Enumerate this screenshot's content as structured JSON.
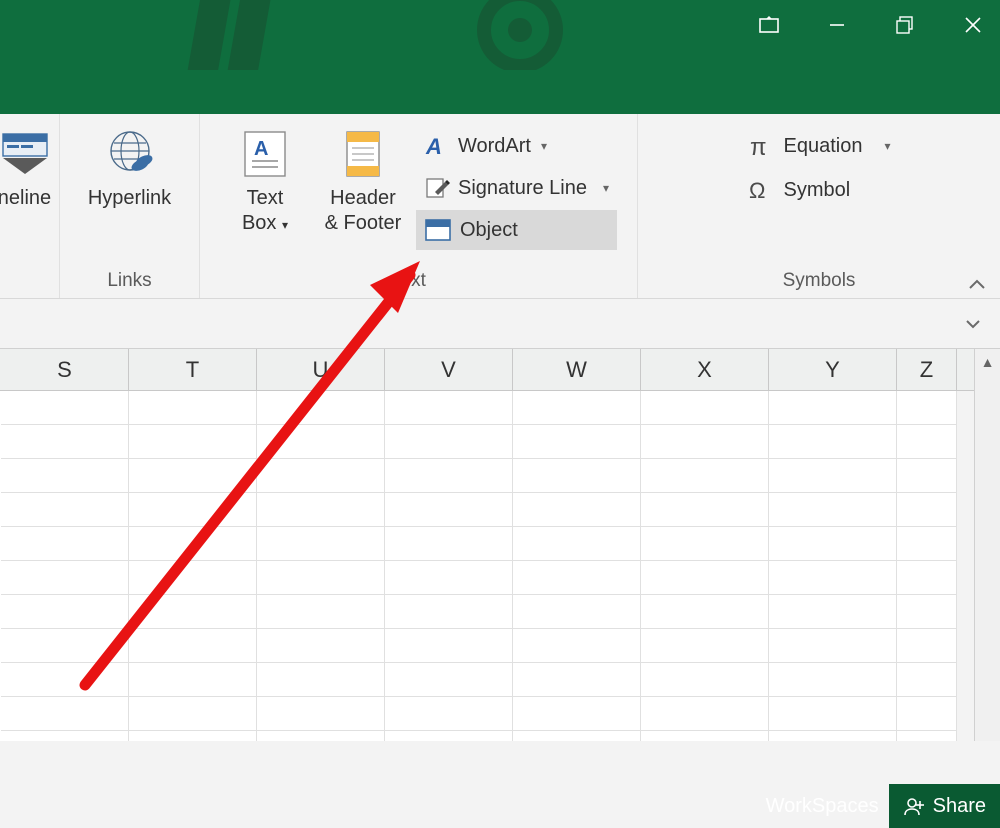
{
  "titlebar": {
    "workspaces_label": "WorkSpaces",
    "share_label": "Share"
  },
  "ribbon": {
    "groups": {
      "filters": {
        "timeline_label": "neline"
      },
      "links": {
        "label": "Links",
        "hyperlink": "Hyperlink"
      },
      "text": {
        "label": "xt",
        "textbox": "Text\nBox",
        "headerfooter": "Header\n& Footer",
        "wordart": "WordArt",
        "signature": "Signature Line",
        "object": "Object"
      },
      "symbols": {
        "label": "Symbols",
        "equation": "Equation",
        "symbol": "Symbol"
      }
    }
  },
  "columns": [
    "S",
    "T",
    "U",
    "V",
    "W",
    "X",
    "Y",
    "Z"
  ]
}
